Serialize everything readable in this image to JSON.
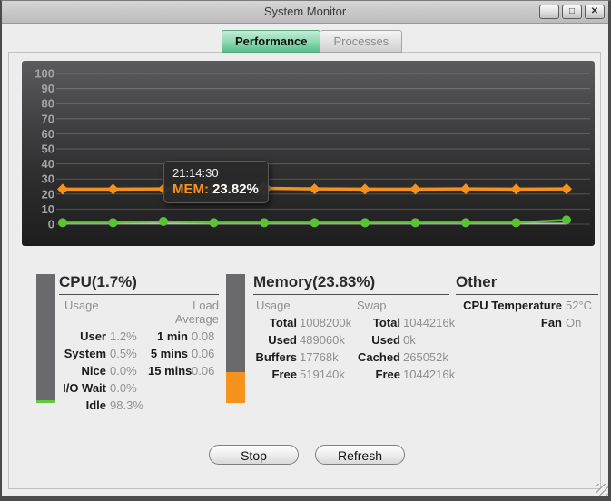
{
  "window": {
    "title": "System Monitor",
    "controls": [
      {
        "name": "minimize",
        "glyph": "_"
      },
      {
        "name": "maximize",
        "glyph": "□"
      },
      {
        "name": "close",
        "glyph": "✕"
      }
    ]
  },
  "tabs": [
    {
      "label": "Performance",
      "active": true
    },
    {
      "label": "Processes",
      "active": false
    }
  ],
  "chart_data": {
    "type": "line",
    "x": [
      0,
      1,
      2,
      3,
      4,
      5,
      6,
      7,
      8,
      9,
      10
    ],
    "series": [
      {
        "name": "baseline",
        "color": "#bdbdbd",
        "marker": "none",
        "values": [
          0.4,
          0.4,
          0.4,
          0.4,
          0.4,
          0.4,
          0.4,
          0.4,
          0.4,
          0.4,
          0.4
        ]
      },
      {
        "name": "CPU",
        "color": "#5cc235",
        "marker": "circle",
        "values": [
          1.0,
          1.0,
          1.8,
          1.0,
          1.0,
          1.0,
          1.0,
          1.0,
          1.0,
          1.0,
          2.8
        ]
      },
      {
        "name": "MEM",
        "color": "#f5921e",
        "marker": "diamond",
        "values": [
          23.3,
          23.3,
          23.4,
          23.3,
          23.82,
          23.4,
          23.3,
          23.3,
          23.4,
          23.3,
          23.4
        ]
      }
    ],
    "ylim": [
      0,
      100
    ],
    "yticks": [
      100,
      90,
      80,
      70,
      60,
      50,
      40,
      30,
      20,
      10,
      0
    ],
    "grid": true,
    "legend": false,
    "tooltip": {
      "time": "21:14:30",
      "label": "MEM:",
      "value": "23.82%",
      "series": "MEM",
      "point_index": 4
    }
  },
  "panels": {
    "cpu": {
      "title": "CPU(1.7%)",
      "gauge": {
        "percent": 1.7,
        "color": "#62c83e",
        "track": "#6a6a6c"
      },
      "col1_header": "Usage",
      "col2_header": "Load Average",
      "usage": [
        {
          "label": "User",
          "value": "1.2%"
        },
        {
          "label": "System",
          "value": "0.5%"
        },
        {
          "label": "Nice",
          "value": "0.0%"
        },
        {
          "label": "I/O Wait",
          "value": "0.0%"
        },
        {
          "label": "Idle",
          "value": "98.3%"
        }
      ],
      "load": [
        {
          "label": "1 min",
          "value": "0.08"
        },
        {
          "label": "5 mins",
          "value": "0.06"
        },
        {
          "label": "15 mins",
          "value": "0.06"
        }
      ]
    },
    "memory": {
      "title": "Memory(23.83%)",
      "gauge": {
        "percent": 23.83,
        "color": "#f6921e",
        "track": "#6a6a6c"
      },
      "col1_header": "Usage",
      "col2_header": "Swap",
      "usage": [
        {
          "label": "Total",
          "value": "1008200k"
        },
        {
          "label": "Used",
          "value": "489060k"
        },
        {
          "label": "Buffers",
          "value": "17768k"
        },
        {
          "label": "Free",
          "value": "519140k"
        }
      ],
      "swap": [
        {
          "label": "Total",
          "value": "1044216k"
        },
        {
          "label": "Used",
          "value": "0k"
        },
        {
          "label": "Cached",
          "value": "265052k"
        },
        {
          "label": "Free",
          "value": "1044216k"
        }
      ]
    },
    "other": {
      "title": "Other",
      "rows": [
        {
          "label": "CPU Temperature",
          "value": "52°C"
        },
        {
          "label": "Fan",
          "value": "On"
        }
      ]
    }
  },
  "buttons": {
    "stop": "Stop",
    "refresh": "Refresh"
  }
}
